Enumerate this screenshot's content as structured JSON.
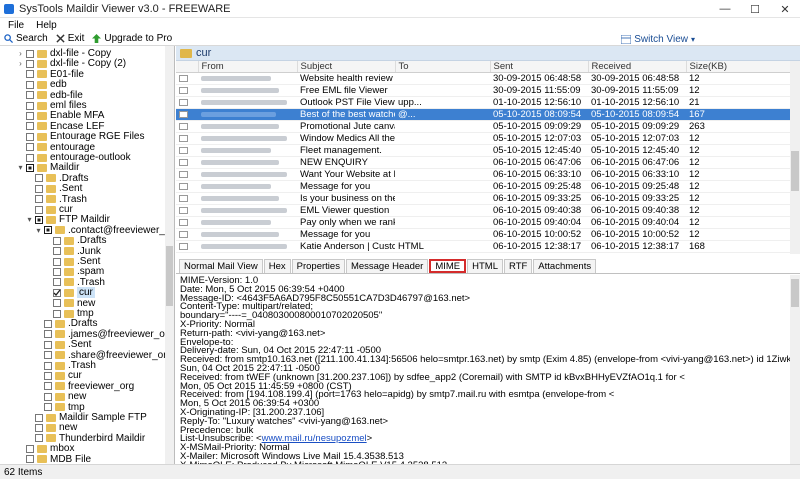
{
  "window": {
    "title": "SysTools Maildir Viewer v3.0 - FREEWARE",
    "minimize": "—",
    "maximize": "☐",
    "close": "✕"
  },
  "menu": [
    "File",
    "Help"
  ],
  "toolbar": {
    "search": "Search",
    "exit": "Exit",
    "upgrade": "Upgrade to Pro",
    "switch_view": "Switch View"
  },
  "tree": [
    {
      "label": "dxl-file - Copy",
      "indent": 3,
      "cb": "",
      "exp": "+"
    },
    {
      "label": "dxl-file - Copy (2)",
      "indent": 3,
      "cb": "",
      "exp": "+"
    },
    {
      "label": "E01-file",
      "indent": 3,
      "cb": "",
      "exp": ""
    },
    {
      "label": "edb",
      "indent": 3,
      "cb": "",
      "exp": ""
    },
    {
      "label": "edb-file",
      "indent": 3,
      "cb": "",
      "exp": ""
    },
    {
      "label": "eml files",
      "indent": 3,
      "cb": "",
      "exp": ""
    },
    {
      "label": "Enable MFA",
      "indent": 3,
      "cb": "",
      "exp": ""
    },
    {
      "label": "Encase LEF",
      "indent": 3,
      "cb": "",
      "exp": ""
    },
    {
      "label": "Entourage RGE Files",
      "indent": 3,
      "cb": "",
      "exp": ""
    },
    {
      "label": "entourage",
      "indent": 3,
      "cb": "",
      "exp": ""
    },
    {
      "label": "entourage-outlook",
      "indent": 3,
      "cb": "",
      "exp": ""
    },
    {
      "label": "Maildir",
      "indent": 3,
      "cb": "partial",
      "exp": "-"
    },
    {
      "label": ".Drafts",
      "indent": 4,
      "cb": "",
      "exp": ""
    },
    {
      "label": ".Sent",
      "indent": 4,
      "cb": "",
      "exp": ""
    },
    {
      "label": ".Trash",
      "indent": 4,
      "cb": "",
      "exp": ""
    },
    {
      "label": "cur",
      "indent": 4,
      "cb": "",
      "exp": ""
    },
    {
      "label": "FTP Maildir",
      "indent": 4,
      "cb": "partial",
      "exp": "-"
    },
    {
      "label": ".contact@freeviewer_org",
      "indent": 5,
      "cb": "partial",
      "exp": "-"
    },
    {
      "label": ".Drafts",
      "indent": 6,
      "cb": "",
      "exp": ""
    },
    {
      "label": ".Junk",
      "indent": 6,
      "cb": "",
      "exp": ""
    },
    {
      "label": ".Sent",
      "indent": 6,
      "cb": "",
      "exp": ""
    },
    {
      "label": ".spam",
      "indent": 6,
      "cb": "",
      "exp": ""
    },
    {
      "label": ".Trash",
      "indent": 6,
      "cb": "",
      "exp": ""
    },
    {
      "label": "cur",
      "indent": 6,
      "cb": "checked",
      "exp": ""
    },
    {
      "label": "new",
      "indent": 6,
      "cb": "",
      "exp": ""
    },
    {
      "label": "tmp",
      "indent": 6,
      "cb": "",
      "exp": ""
    },
    {
      "label": ".Drafts",
      "indent": 5,
      "cb": "",
      "exp": ""
    },
    {
      "label": ".james@freeviewer_org",
      "indent": 5,
      "cb": "",
      "exp": ""
    },
    {
      "label": ".Sent",
      "indent": 5,
      "cb": "",
      "exp": ""
    },
    {
      "label": ".share@freeviewer_org",
      "indent": 5,
      "cb": "",
      "exp": ""
    },
    {
      "label": ".Trash",
      "indent": 5,
      "cb": "",
      "exp": ""
    },
    {
      "label": "cur",
      "indent": 5,
      "cb": "",
      "exp": ""
    },
    {
      "label": "freeviewer_org",
      "indent": 5,
      "cb": "",
      "exp": ""
    },
    {
      "label": "new",
      "indent": 5,
      "cb": "",
      "exp": ""
    },
    {
      "label": "tmp",
      "indent": 5,
      "cb": "",
      "exp": ""
    },
    {
      "label": "Maildir Sample FTP",
      "indent": 4,
      "cb": "",
      "exp": ""
    },
    {
      "label": "new",
      "indent": 4,
      "cb": "",
      "exp": ""
    },
    {
      "label": "Thunderbird Maildir",
      "indent": 4,
      "cb": "",
      "exp": ""
    },
    {
      "label": "mbox",
      "indent": 3,
      "cb": "",
      "exp": ""
    },
    {
      "label": "MDB File",
      "indent": 3,
      "cb": "",
      "exp": ""
    }
  ],
  "folder_header": "cur",
  "columns": [
    "",
    "From",
    "Subject",
    "To",
    "Sent",
    "Received",
    "Size(KB)"
  ],
  "mails": [
    {
      "subject": "Website health review for:free...",
      "to": "",
      "sent": "30-09-2015 06:48:58",
      "received": "30-09-2015 06:48:58",
      "size": "12",
      "sel": false
    },
    {
      "subject": "Free EML file Viewer",
      "to": "",
      "sent": "30-09-2015 11:55:09",
      "received": "30-09-2015 11:55:09",
      "size": "12",
      "sel": false
    },
    {
      "subject": "Outlook PST File Viewer Pro Pl...",
      "to": "upp...",
      "sent": "01-10-2015 12:56:10",
      "received": "01-10-2015 12:56:10",
      "size": "21",
      "sel": false
    },
    {
      "subject": "Best of the best watches.",
      "to": "@...",
      "sent": "05-10-2015 08:09:54",
      "received": "05-10-2015 08:09:54",
      "size": "167",
      "sel": true
    },
    {
      "subject": "Promotional Jute canvas bags ...",
      "to": "",
      "sent": "05-10-2015 09:09:29",
      "received": "05-10-2015 09:09:29",
      "size": "263",
      "sel": false
    },
    {
      "subject": "Window Medics All the benefit...",
      "to": "",
      "sent": "05-10-2015 12:07:03",
      "received": "05-10-2015 12:07:03",
      "size": "12",
      "sel": false
    },
    {
      "subject": "Fleet management.",
      "to": "",
      "sent": "05-10-2015 12:45:40",
      "received": "05-10-2015 12:45:40",
      "size": "12",
      "sel": false
    },
    {
      "subject": "NEW ENQUIRY",
      "to": "",
      "sent": "06-10-2015 06:47:06",
      "received": "06-10-2015 06:47:06",
      "size": "12",
      "sel": false
    },
    {
      "subject": "Want Your Website at First Pag...",
      "to": "",
      "sent": "06-10-2015 06:33:10",
      "received": "06-10-2015 06:33:10",
      "size": "12",
      "sel": false
    },
    {
      "subject": "Message for you",
      "to": "",
      "sent": "06-10-2015 09:25:48",
      "received": "06-10-2015 09:25:48",
      "size": "12",
      "sel": false
    },
    {
      "subject": "Is your business on the first pa...",
      "to": "",
      "sent": "06-10-2015 09:33:25",
      "received": "06-10-2015 09:33:25",
      "size": "12",
      "sel": false
    },
    {
      "subject": "EML Viewer question",
      "to": "",
      "sent": "06-10-2015 09:40:38",
      "received": "06-10-2015 09:40:38",
      "size": "12",
      "sel": false
    },
    {
      "subject": "Pay only when we rank your ke...",
      "to": "",
      "sent": "06-10-2015 09:40:04",
      "received": "06-10-2015 09:40:04",
      "size": "12",
      "sel": false
    },
    {
      "subject": "Message for you",
      "to": "",
      "sent": "06-10-2015 10:00:52",
      "received": "06-10-2015 10:00:52",
      "size": "12",
      "sel": false
    },
    {
      "subject": "Katie Anderson | Custom Tote...",
      "to": "HTML",
      "sent": "06-10-2015 12:38:17",
      "received": "06-10-2015 12:38:17",
      "size": "168",
      "sel": false
    }
  ],
  "tabs": [
    "Normal Mail View",
    "Hex",
    "Properties",
    "Message Header",
    "MIME",
    "HTML",
    "RTF",
    "Attachments"
  ],
  "active_tab": "MIME",
  "mime_lines": [
    "MIME-Version: 1.0",
    "Date: Mon, 5 Oct 2015 06:39:54 +0400",
    "Message-ID: <4643F5A6AD795F8C50551CA7D3D46797@163.net>",
    "Content-Type: multipart/related;",
    "        boundary=\"----=_040803000800010702020505\"",
    "X-Priority: Normal",
    "Return-path: <vivi-yang@163.net>",
    "Envelope-to:",
    "Delivery-date: Sun, 04 Oct 2015 22:47:11 -0500",
    "Received: from smtp10.163.net ([211.100.41.134]:56506 helo=smtpr.163.net) by smtp (Exim 4.85) (envelope-from <vivi-yang@163.net>) id 1Ziwk1-0004Sw-R9 for contact@freeviewer.org;",
    "        Sun, 04 Oct 2015 22:47:11 -0500",
    "Received: from tWEF (unknown [31.200.237.106]) by sdfee_app2 (Coremail) with SMTP id kBvxBHHyEVZfAO1q.1 for <",
    "        Mon, 05 Oct 2015 11:45:59 +0800 (CST)",
    "Received: from [194.108.199.4] (port=1763 helo=apidg) by smtp7.mail.ru with esmtpa (envelope-from <",
    "        Mon, 5 Oct 2015 06:39:54 +0300",
    "X-Originating-IP: [31.200.237.106]",
    "Reply-To: \"Luxury watches\" <vivi-yang@163.net>",
    "Precedence: bulk",
    "List-Unsubscribe: <www.mail.ru/nesupozmel>",
    "X-MSMail-Priority: Normal",
    "X-Mailer: Microsoft Windows Live Mail 15.4.3538.513",
    "X-MimeOLE: Produced By Microsoft MimeOLE V15.4.3538.513"
  ],
  "status": "62 Items"
}
